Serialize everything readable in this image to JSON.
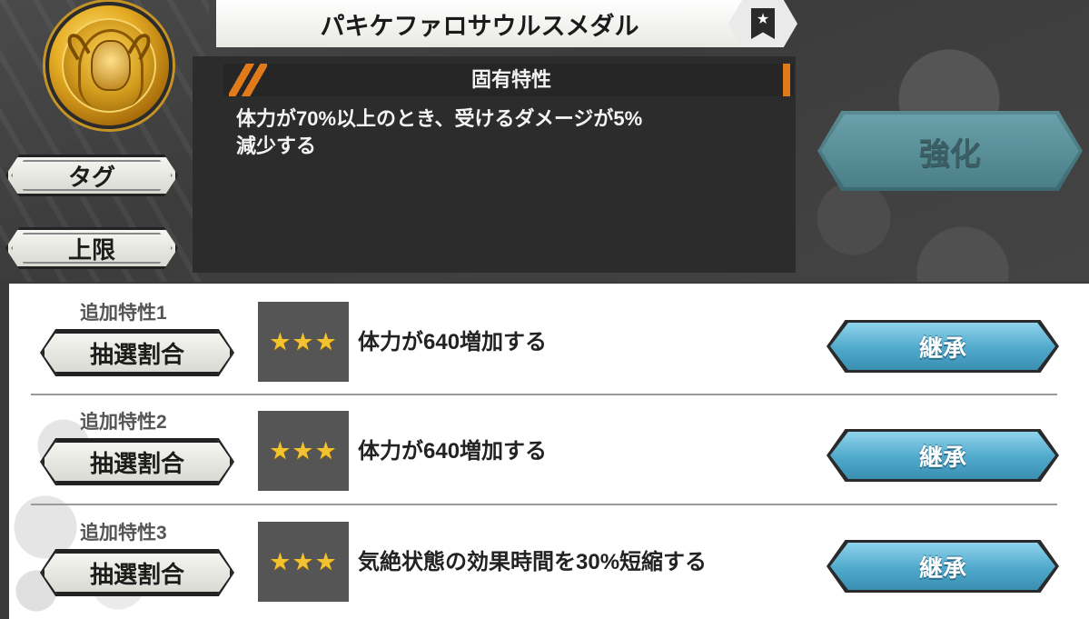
{
  "medal": {
    "title": "パキケファロサウルスメダル",
    "icon": "medal-portrait-icon",
    "favorite_icon": "star-bookmark-icon"
  },
  "unique_trait": {
    "header": "固有特性",
    "description_line1": "体力が70%以上のとき、受けるダメージが5%",
    "description_line2": "減少する"
  },
  "side_buttons": {
    "tag": "タグ",
    "limit": "上限"
  },
  "enhance_button": "強化",
  "additional_traits": [
    {
      "label": "追加特性1",
      "lottery": "抽選割合",
      "stars": "★★★",
      "rating": 3,
      "text": "体力が640増加する",
      "inherit": "継承"
    },
    {
      "label": "追加特性2",
      "lottery": "抽選割合",
      "stars": "★★★",
      "rating": 3,
      "text": "体力が640増加する",
      "inherit": "継承"
    },
    {
      "label": "追加特性3",
      "lottery": "抽選割合",
      "stars": "★★★",
      "rating": 3,
      "text": "気絶状態の効果時間を30%短縮する",
      "inherit": "継承"
    }
  ],
  "colors": {
    "accent_orange": "#e07a1a",
    "inherit_blue": "#4fa9cb",
    "enhance_teal": "#4a7f88",
    "star_gold": "#f2c230"
  }
}
